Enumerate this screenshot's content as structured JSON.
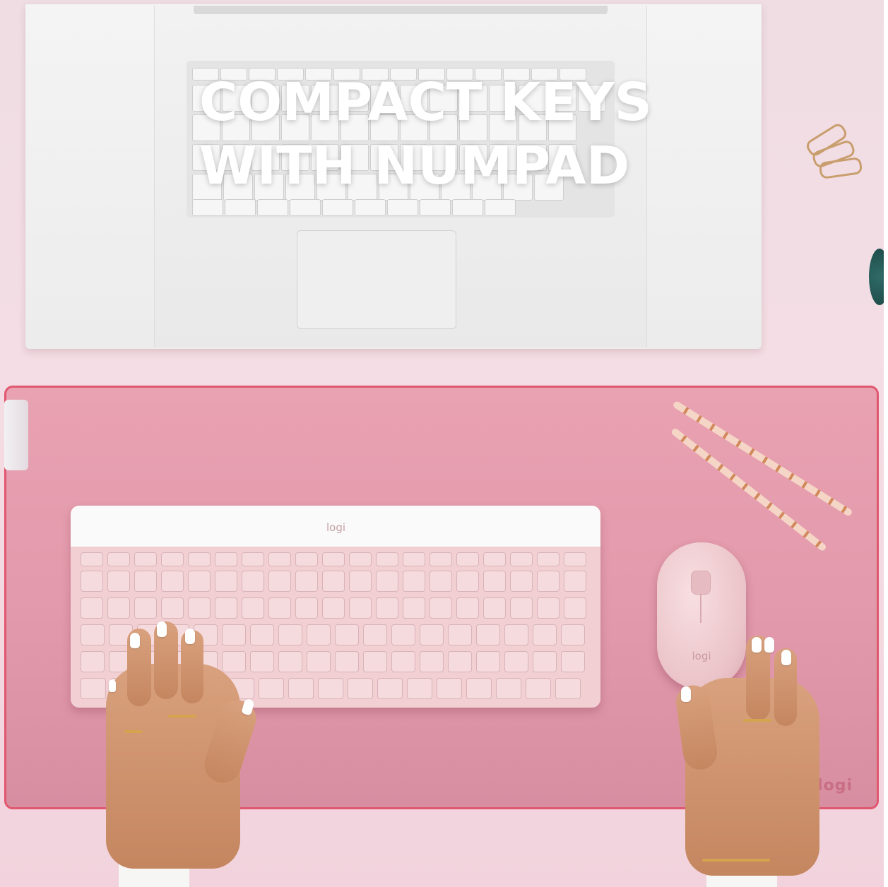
{
  "headline": {
    "line1": "COMPACT KEYS",
    "line2": "WITH NUMPAD"
  },
  "keyboard": {
    "logo": "logi",
    "color": "#f1cfd3"
  },
  "mouse": {
    "logo": "logi",
    "color": "#efcdd2"
  },
  "deskmat": {
    "logo": "logi",
    "color": "#e29aac"
  },
  "colors": {
    "background": "#f3d9e1",
    "headline_text": "#ffffff",
    "mat_border": "#e0576f"
  }
}
